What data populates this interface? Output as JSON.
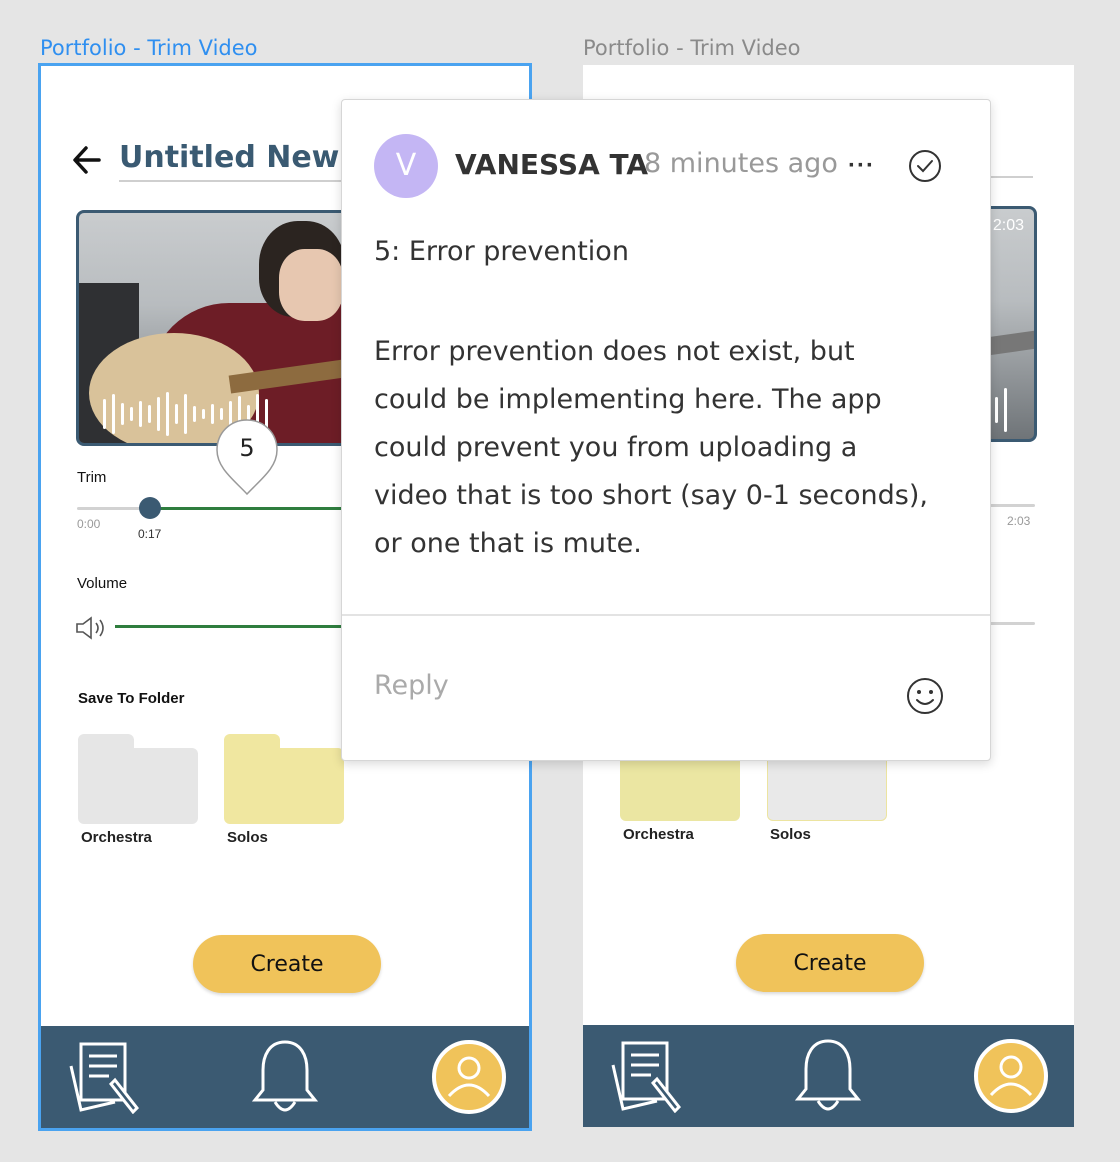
{
  "frames": {
    "left_label": "Portfolio - Trim Video",
    "right_label": "Portfolio - Trim Video"
  },
  "screen": {
    "title": "Untitled New V",
    "video_duration": "2:03",
    "trim": {
      "label": "Trim",
      "start_time": "0:00",
      "handle_time": "0:17",
      "end_time": "2:03"
    },
    "volume_label": "Volume",
    "save_to_folder_label": "Save To Folder",
    "left_folders": [
      {
        "name": "Orchestra",
        "color": "#e6e6e6"
      },
      {
        "name": "Solos",
        "color": "#f0e7a0"
      }
    ],
    "right_folders": [
      {
        "name": "Orchestra",
        "color": "#ebe6a2"
      },
      {
        "name": "Solos",
        "color": "#e9e9e9"
      }
    ],
    "create_label": "Create",
    "tabbar_icons": [
      "portfolio-icon",
      "bell-icon",
      "profile-icon"
    ]
  },
  "comment_pin": {
    "number": "5"
  },
  "comment": {
    "avatar_initial": "V",
    "author": "VANESSA TA",
    "time_ago": "8 minutes ago",
    "more_label": "···",
    "heading": "5: Error prevention",
    "body": "Error prevention does not exist, but could be implementing here. The app could prevent you from uploading a video that is too short (say 0-1 seconds), or one that is mute.",
    "reply_placeholder": "Reply"
  },
  "colors": {
    "accent": "#3b5a72",
    "create_button": "#f0c35a",
    "selection": "#4aa3f0",
    "slider_fill": "#2e7d3e",
    "avatar": "#c4b6f4"
  }
}
